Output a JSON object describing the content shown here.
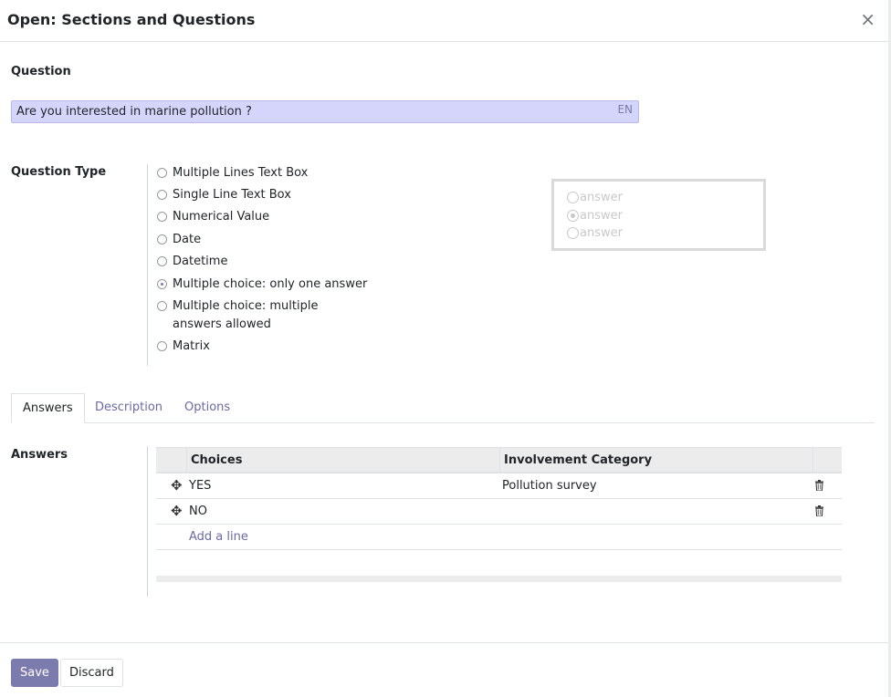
{
  "dialog": {
    "title": "Open: Sections and Questions",
    "close_symbol": "×"
  },
  "question": {
    "label": "Question",
    "value": "Are you interested in marine pollution ?",
    "lang": "EN"
  },
  "question_type": {
    "label": "Question Type",
    "options": [
      {
        "label": "Multiple Lines Text Box",
        "checked": false
      },
      {
        "label": "Single Line Text Box",
        "checked": false
      },
      {
        "label": "Numerical Value",
        "checked": false
      },
      {
        "label": "Date",
        "checked": false
      },
      {
        "label": "Datetime",
        "checked": false
      },
      {
        "label": "Multiple choice: only one answer",
        "checked": true
      },
      {
        "label": "Multiple choice: multiple answers allowed",
        "checked": false
      },
      {
        "label": "Matrix",
        "checked": false
      }
    ]
  },
  "preview": {
    "items": [
      "answer",
      "answer",
      "answer"
    ],
    "selected_index": 1
  },
  "tabs": [
    {
      "label": "Answers",
      "active": true
    },
    {
      "label": "Description",
      "active": false
    },
    {
      "label": "Options",
      "active": false
    }
  ],
  "answers": {
    "label": "Answers",
    "columns": [
      "Choices",
      "Involvement Category"
    ],
    "rows": [
      {
        "choice": "YES",
        "category": "Pollution survey"
      },
      {
        "choice": "NO",
        "category": ""
      }
    ],
    "add_line": "Add a line"
  },
  "footer": {
    "save_label": "Save",
    "discard_label": "Discard"
  },
  "colors": {
    "accent": "#7c7bad",
    "input_bg": "#d5d5fb"
  }
}
